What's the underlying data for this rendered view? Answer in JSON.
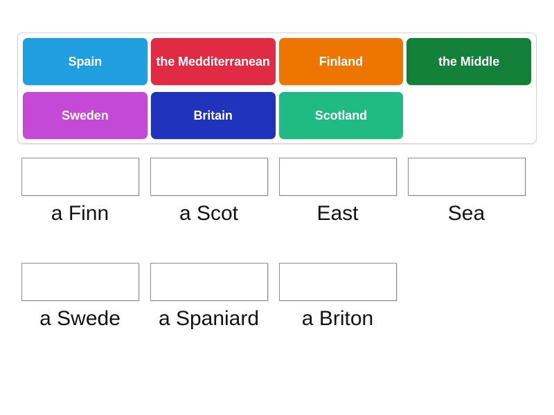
{
  "activity": {
    "type": "drag-and-drop-match",
    "tile_text_color": "#ffffff"
  },
  "tray": {
    "tiles": [
      {
        "label": "Spain",
        "color": "#1f9ee0"
      },
      {
        "label": "the Medditerranean",
        "color": "#e12a44"
      },
      {
        "label": "Finland",
        "color": "#ef7501"
      },
      {
        "label": "the Middle",
        "color": "#13803a"
      },
      {
        "label": "Sweden",
        "color": "#c44ad6"
      },
      {
        "label": "Britain",
        "color": "#1f32bb"
      },
      {
        "label": "Scotland",
        "color": "#20bb85"
      }
    ]
  },
  "answers": {
    "row_one": [
      {
        "label": "a Finn",
        "value": ""
      },
      {
        "label": "a Scot",
        "value": ""
      },
      {
        "label": "East",
        "value": ""
      },
      {
        "label": "Sea",
        "value": ""
      }
    ],
    "row_two": [
      {
        "label": "a Swede",
        "value": ""
      },
      {
        "label": "a Spaniard",
        "value": ""
      },
      {
        "label": "a Briton",
        "value": ""
      }
    ]
  }
}
